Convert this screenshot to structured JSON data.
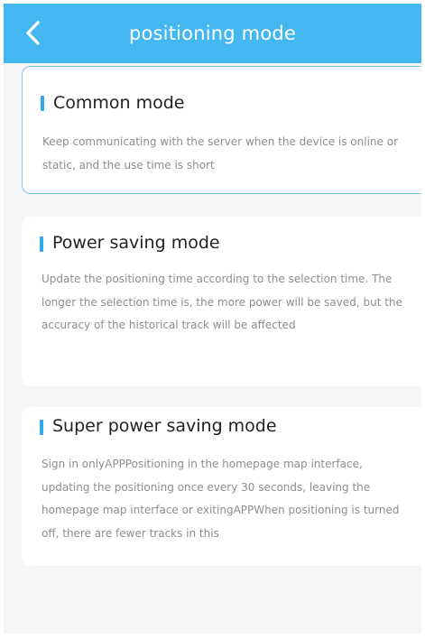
{
  "header": {
    "title": "positioning mode",
    "back_icon": "chevron-left-icon",
    "background_color": "#45b7f0"
  },
  "modes": [
    {
      "title": "Common mode",
      "description": "Keep communicating with the server when the device is online or static, and the use time is short",
      "selected": true
    },
    {
      "title": "Power saving mode",
      "description": "Update the positioning time according to the selection time. The longer the selection time is, the more power will be saved, but the accuracy of the historical track will be affected",
      "selected": false
    },
    {
      "title": "Super power saving mode",
      "description": "Sign in onlyAPPPositioning in the homepage map interface, updating the positioning once every 30 seconds, leaving the homepage map interface or exitingAPPWhen positioning is turned off, there are fewer tracks in this",
      "selected": false
    }
  ],
  "colors": {
    "accent": "#2ea9ec",
    "selected_border": "#7cc8ee",
    "description_text": "#8d8d8d"
  }
}
